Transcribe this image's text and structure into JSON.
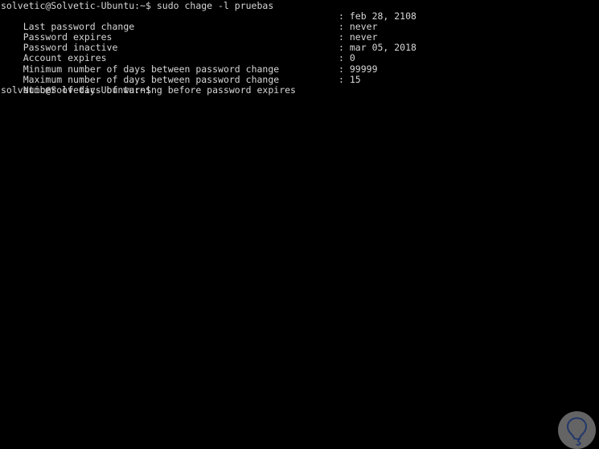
{
  "terminal": {
    "prompt": "solvetic@Solvetic-Ubuntu:~$",
    "command": " sudo chage -l pruebas",
    "command_line": "solvetic@Solvetic-Ubuntu:~$ sudo chage -l pruebas",
    "final_prompt": "solvetic@Solvetic-Ubuntu:~$",
    "colors": {
      "background": "#000000",
      "foreground": "#d6d6d6"
    },
    "output": [
      {
        "label": "Last password change",
        "separator": ":",
        "value": "feb 28, 2108"
      },
      {
        "label": "Password expires",
        "separator": ":",
        "value": "never"
      },
      {
        "label": "Password inactive",
        "separator": ":",
        "value": "never"
      },
      {
        "label": "Account expires",
        "separator": ":",
        "value": "mar 05, 2018"
      },
      {
        "label": "Minimum number of days between password change",
        "separator": ":",
        "value": "0"
      },
      {
        "label": "Maximum number of days between password change",
        "separator": ":",
        "value": "99999"
      },
      {
        "label": "Number of days of warning before password expires",
        "separator": ":",
        "value": "15"
      }
    ]
  },
  "watermark": {
    "icon": "lightbulb-icon",
    "disc_color": "#6d6d6d",
    "bulb_color": "#23386b"
  }
}
